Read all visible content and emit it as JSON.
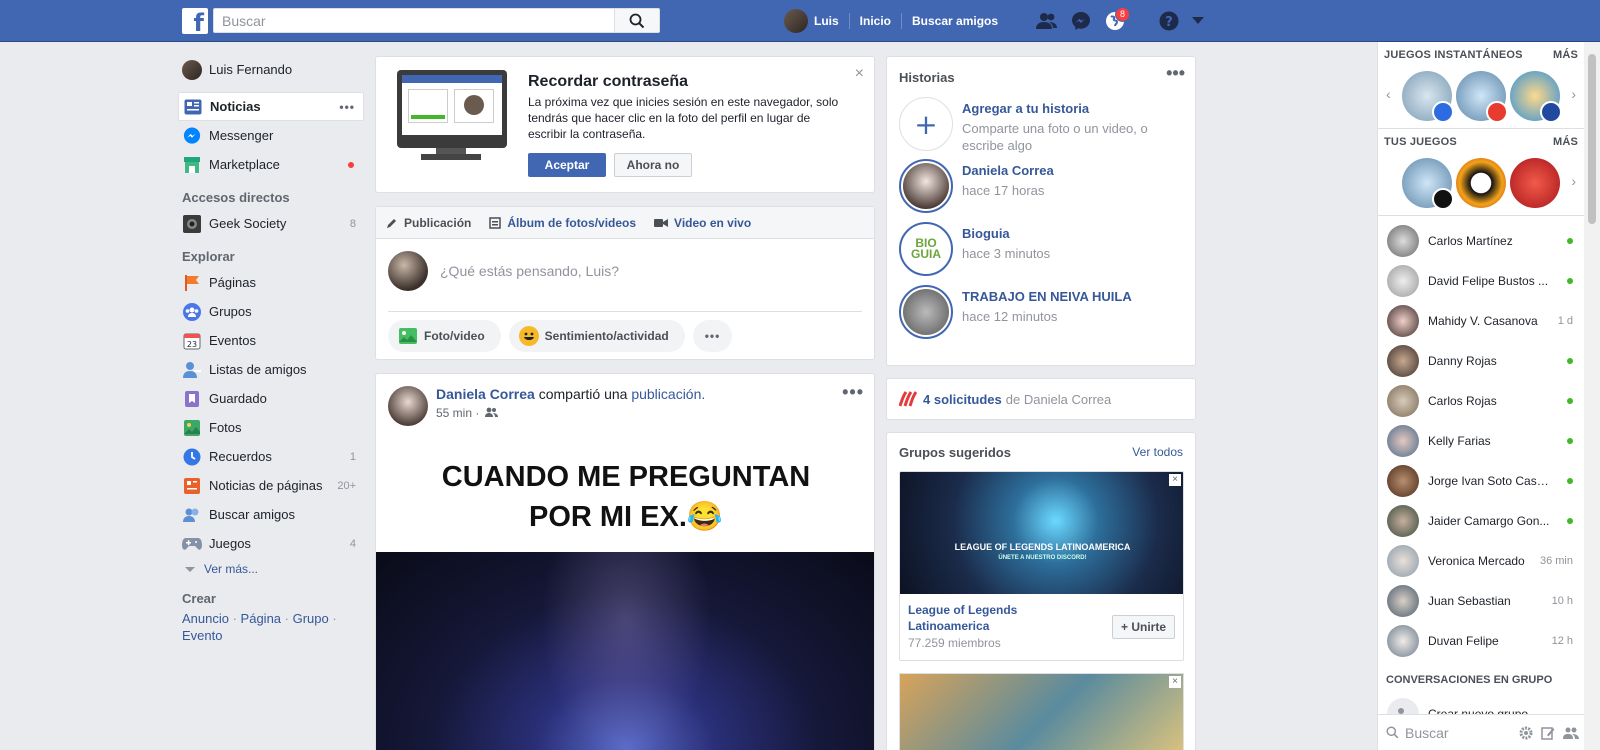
{
  "header": {
    "search_placeholder": "Buscar",
    "user_name": "Luis",
    "nav_home": "Inicio",
    "nav_find_friends": "Buscar amigos",
    "notifications_count": "8"
  },
  "leftnav": {
    "profile_name": "Luis Fernando",
    "main_items": [
      {
        "label": "Noticias",
        "icon": "news-feed-icon",
        "more": "•••"
      },
      {
        "label": "Messenger",
        "icon": "messenger-icon"
      },
      {
        "label": "Marketplace",
        "icon": "marketplace-icon"
      }
    ],
    "shortcuts_head": "Accesos directos",
    "shortcuts": [
      {
        "label": "Geek Society",
        "count": "8"
      }
    ],
    "explore_head": "Explorar",
    "explore": [
      {
        "label": "Páginas",
        "count": ""
      },
      {
        "label": "Grupos",
        "count": ""
      },
      {
        "label": "Eventos",
        "count": ""
      },
      {
        "label": "Listas de amigos",
        "count": ""
      },
      {
        "label": "Guardado",
        "count": ""
      },
      {
        "label": "Fotos",
        "count": ""
      },
      {
        "label": "Recuerdos",
        "count": "1"
      },
      {
        "label": "Noticias de páginas",
        "count": "20+"
      },
      {
        "label": "Buscar amigos",
        "count": ""
      },
      {
        "label": "Juegos",
        "count": "4"
      }
    ],
    "see_more": "Ver más...",
    "create_head": "Crear",
    "create_links": [
      "Anuncio",
      "Página",
      "Grupo",
      "Evento"
    ]
  },
  "password_card": {
    "title": "Recordar contraseña",
    "text": "La próxima vez que inicies sesión en este navegador, solo tendrás que hacer clic en la foto del perfil en lugar de escribir la contraseña.",
    "accept": "Aceptar",
    "decline": "Ahora no",
    "close": "×"
  },
  "composer": {
    "tab_post": "Publicación",
    "tab_album": "Álbum de fotos/videos",
    "tab_live": "Video en vivo",
    "placeholder": "¿Qué estás pensando, Luis?",
    "action_photo": "Foto/video",
    "action_feeling": "Sentimiento/actividad",
    "action_more": "•••"
  },
  "post": {
    "author": "Daniela Correa",
    "shared_text": "compartió una",
    "shared_link": "publicación.",
    "time": "55 min ·",
    "dots": "•••",
    "meme_line1": "CUANDO ME PREGUNTAN",
    "meme_line2": "POR MI EX.😂"
  },
  "stories": {
    "title": "Historias",
    "dots": "•••",
    "add_title": "Agregar a tu historia",
    "add_sub": "Comparte una foto o un video, o escribe algo",
    "items": [
      {
        "name": "Daniela Correa",
        "time": "hace 17 horas"
      },
      {
        "name": "Bioguia",
        "time": "hace 3 minutos"
      },
      {
        "name": "TRABAJO EN NEIVA HUILA",
        "time": "hace 12 minutos"
      }
    ]
  },
  "requests": {
    "count_text": "4 solicitudes",
    "from_text": "de Daniela Correa"
  },
  "groups": {
    "title": "Grupos sugeridos",
    "see_all": "Ver todos",
    "card_banner": "LEAGUE OF LEGENDS LATINOAMERICA",
    "card_banner_sub": "ÚNETE A NUESTRO DISCORD!",
    "card_name": "League of Legends Latinoamerica",
    "card_members": "77.259 miembros",
    "join": "+ Unirte",
    "close": "×"
  },
  "chat": {
    "instant_games": "JUEGOS INSTANTÁNEOS",
    "your_games": "TUS JUEGOS",
    "more": "MÁS",
    "contacts": [
      {
        "name": "Carlos Martínez",
        "status": "online",
        "time": ""
      },
      {
        "name": "David Felipe Bustos ...",
        "status": "online",
        "time": ""
      },
      {
        "name": "Mahidy V. Casanova",
        "status": "away",
        "time": "1 d"
      },
      {
        "name": "Danny Rojas",
        "status": "online",
        "time": ""
      },
      {
        "name": "Carlos Rojas",
        "status": "online",
        "time": ""
      },
      {
        "name": "Kelly Farias",
        "status": "online",
        "time": ""
      },
      {
        "name": "Jorge Ivan Soto Cast...",
        "status": "online",
        "time": ""
      },
      {
        "name": "Jaider Camargo Gon...",
        "status": "online",
        "time": ""
      },
      {
        "name": "Veronica Mercado",
        "status": "away",
        "time": "36 min"
      },
      {
        "name": "Juan Sebastian",
        "status": "away",
        "time": "10 h"
      },
      {
        "name": "Duvan Felipe",
        "status": "away",
        "time": "12 h"
      }
    ],
    "group_conversations": "CONVERSACIONES EN GRUPO",
    "new_group": "Crear nuevo grupo",
    "search_placeholder": "Buscar"
  },
  "colors": {
    "brand": "#4267b2",
    "link": "#365899",
    "online": "#42b72a",
    "notification": "#fa3e3e"
  }
}
